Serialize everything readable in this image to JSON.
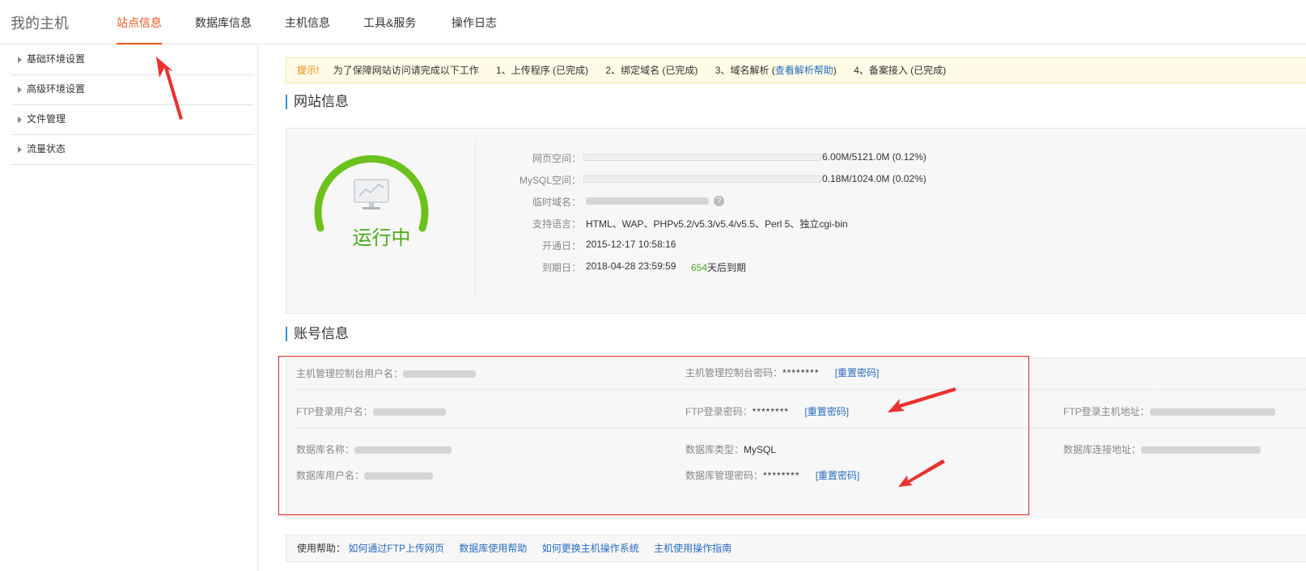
{
  "header": {
    "brand": "我的主机",
    "nav": [
      "站点信息",
      "数据库信息",
      "主机信息",
      "工具&服务",
      "操作日志"
    ]
  },
  "sidebar": {
    "items": [
      "基础环境设置",
      "高级环境设置",
      "文件管理",
      "流量状态"
    ]
  },
  "notice": {
    "hint": "提示!",
    "text": "为了保障网站访问请完成以下工作",
    "step1": "1、上传程序 (已完成)",
    "step2": "2、绑定域名 (已完成)",
    "step3_prefix": "3、域名解析 (",
    "step3_link": "查看解析帮助",
    "step3_suffix": ")",
    "step4": "4、备案接入 (已完成)"
  },
  "site": {
    "title": "网站信息",
    "status": "运行中",
    "rows": {
      "web_space_label": "网页空间：",
      "web_space_value": "6.00M/5121.0M (0.12%)",
      "web_space_fraction": 0.0012,
      "mysql_space_label": "MySQL空间：",
      "mysql_space_value": "0.18M/1024.0M (0.02%)",
      "mysql_space_fraction": 0.0002,
      "temp_domain_label": "临时域名：",
      "lang_label": "支持语言：",
      "lang_value": "HTML、WAP、PHPv5.2/v5.3/v5.4/v5.5、Perl 5、独立cgi-bin",
      "open_label": "开通日：",
      "open_value": "2015-12-17 10:58:16",
      "expire_label": "到期日：",
      "expire_value": "2018-04-28 23:59:59",
      "days_left": "654",
      "days_suffix": "天后到期"
    }
  },
  "account": {
    "title": "账号信息",
    "console_user_label": "主机管理控制台用户名：",
    "console_pwd_label": "主机管理控制台密码：",
    "console_pwd": "********",
    "ftp_user_label": "FTP登录用户名：",
    "ftp_pwd_label": "FTP登录密码：",
    "ftp_pwd": "********",
    "ftp_host_label": "FTP登录主机地址：",
    "db_name_label": "数据库名称：",
    "db_type_label": "数据库类型：",
    "db_type": "MySQL",
    "db_host_label": "数据库连接地址：",
    "db_user_label": "数据库用户名：",
    "db_pwd_label": "数据库管理密码：",
    "db_pwd": "********",
    "reset": "[重置密码]"
  },
  "help": {
    "label": "使用帮助：",
    "links": [
      "如何通过FTP上传网页",
      "数据库使用帮助",
      "如何更换主机操作系统",
      "主机使用操作指南"
    ]
  },
  "colors": {
    "accent": "#e8561f",
    "running": "#4caa1c",
    "link": "#2a6bbf",
    "highlight": "#d8262a"
  }
}
